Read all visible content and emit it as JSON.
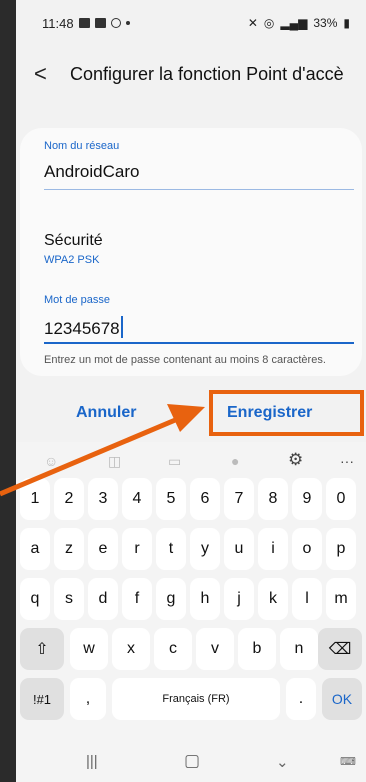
{
  "status": {
    "time": "11:48",
    "battery": "33%"
  },
  "header": {
    "title": "Configurer la fonction Point d'accè"
  },
  "form": {
    "network_label": "Nom du réseau",
    "network_value": "AndroidCaro",
    "security_label": "Sécurité",
    "security_value": "WPA2 PSK",
    "password_label": "Mot de passe",
    "password_value": "12345678",
    "hint": "Entrez un mot de passe contenant au moins 8 caractères."
  },
  "buttons": {
    "cancel": "Annuler",
    "save": "Enregistrer"
  },
  "keyboard": {
    "row_numbers": [
      "1",
      "2",
      "3",
      "4",
      "5",
      "6",
      "7",
      "8",
      "9",
      "0"
    ],
    "row_1": [
      "a",
      "z",
      "e",
      "r",
      "t",
      "y",
      "u",
      "i",
      "o",
      "p"
    ],
    "row_2": [
      "q",
      "s",
      "d",
      "f",
      "g",
      "h",
      "j",
      "k",
      "l",
      "m"
    ],
    "row_3": [
      "w",
      "x",
      "c",
      "v",
      "b",
      "n"
    ],
    "symbols": "!#1",
    "comma": ",",
    "space": "Français (FR)",
    "period": ".",
    "ok": "OK",
    "shift_icon": "shift-icon",
    "backspace_icon": "backspace-icon"
  },
  "annotation": {
    "highlight_color": "#e8620f"
  }
}
